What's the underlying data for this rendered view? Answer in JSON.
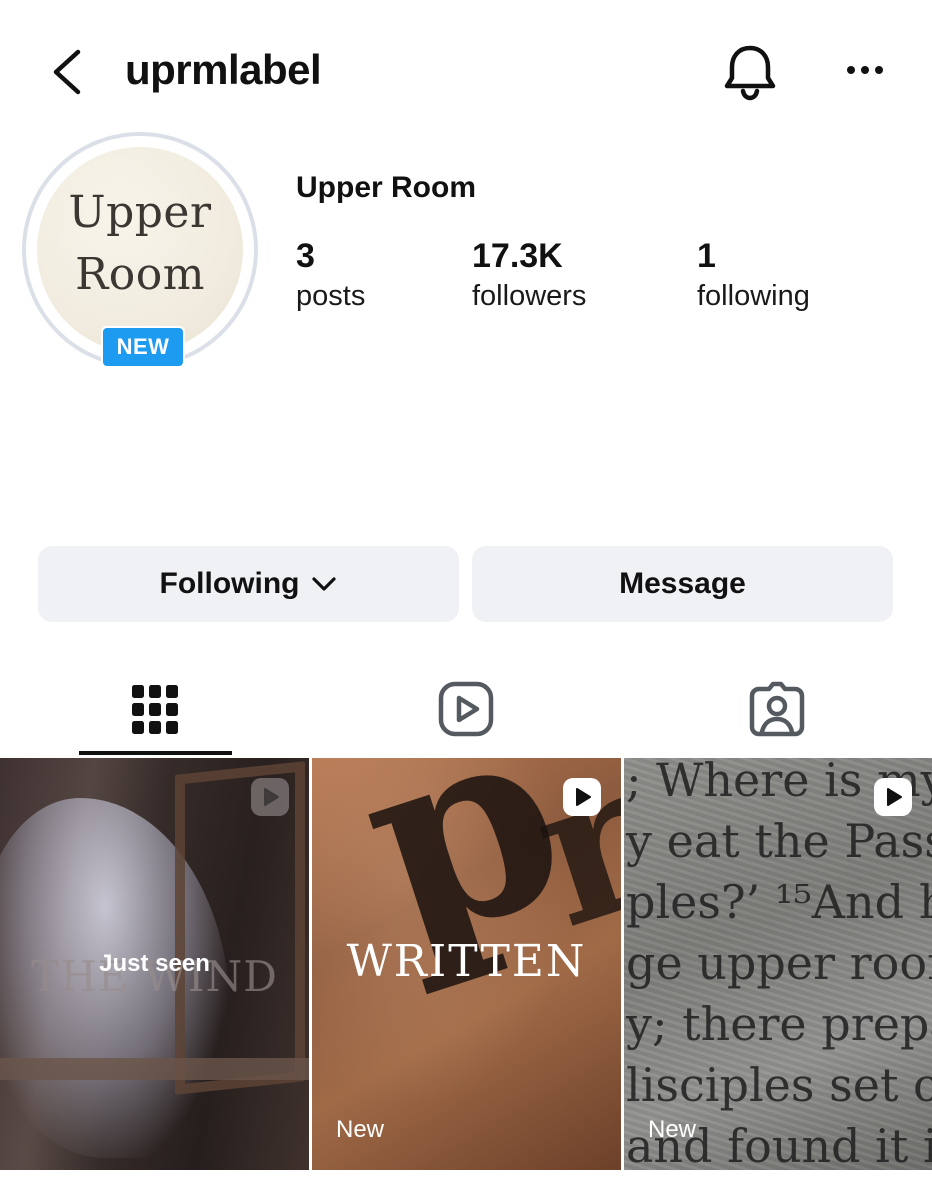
{
  "header": {
    "username": "uprmlabel",
    "icons": {
      "back": "chevron-left-icon",
      "bell": "bell-icon",
      "more": "more-horizontal-icon"
    }
  },
  "profile": {
    "avatar_text": [
      "Upper",
      "Room"
    ],
    "new_badge": "NEW",
    "display_name": "Upper Room",
    "stats": [
      {
        "value": "3",
        "label": "posts"
      },
      {
        "value": "17.3K",
        "label": "followers"
      },
      {
        "value": "1",
        "label": "following"
      }
    ]
  },
  "actions": {
    "following_label": "Following",
    "message_label": "Message"
  },
  "tabs": {
    "items": [
      {
        "icon": "grid-icon",
        "active": true
      },
      {
        "icon": "reels-icon",
        "active": false
      },
      {
        "icon": "tagged-icon",
        "active": false
      }
    ]
  },
  "posts": [
    {
      "title": "THE WIND",
      "overlay": "Just seen",
      "badge": "",
      "reel_icon": "reel-badge-icon"
    },
    {
      "title": "WRITTEN",
      "overlay": "",
      "badge": "New",
      "reel_icon": "reel-badge-icon"
    },
    {
      "title": "",
      "overlay": "",
      "badge": "New",
      "reel_icon": "reel-badge-icon",
      "scripture_lines": [
        "; Where is my",
        "y eat the Pass",
        "ples?’ ¹⁵And h",
        "ge upper roon",
        "y; there prepa",
        "lisciples set o",
        "and found it i"
      ]
    }
  ],
  "colors": {
    "badge_blue": "#1d9bf0",
    "button_bg": "#eff1f4"
  }
}
